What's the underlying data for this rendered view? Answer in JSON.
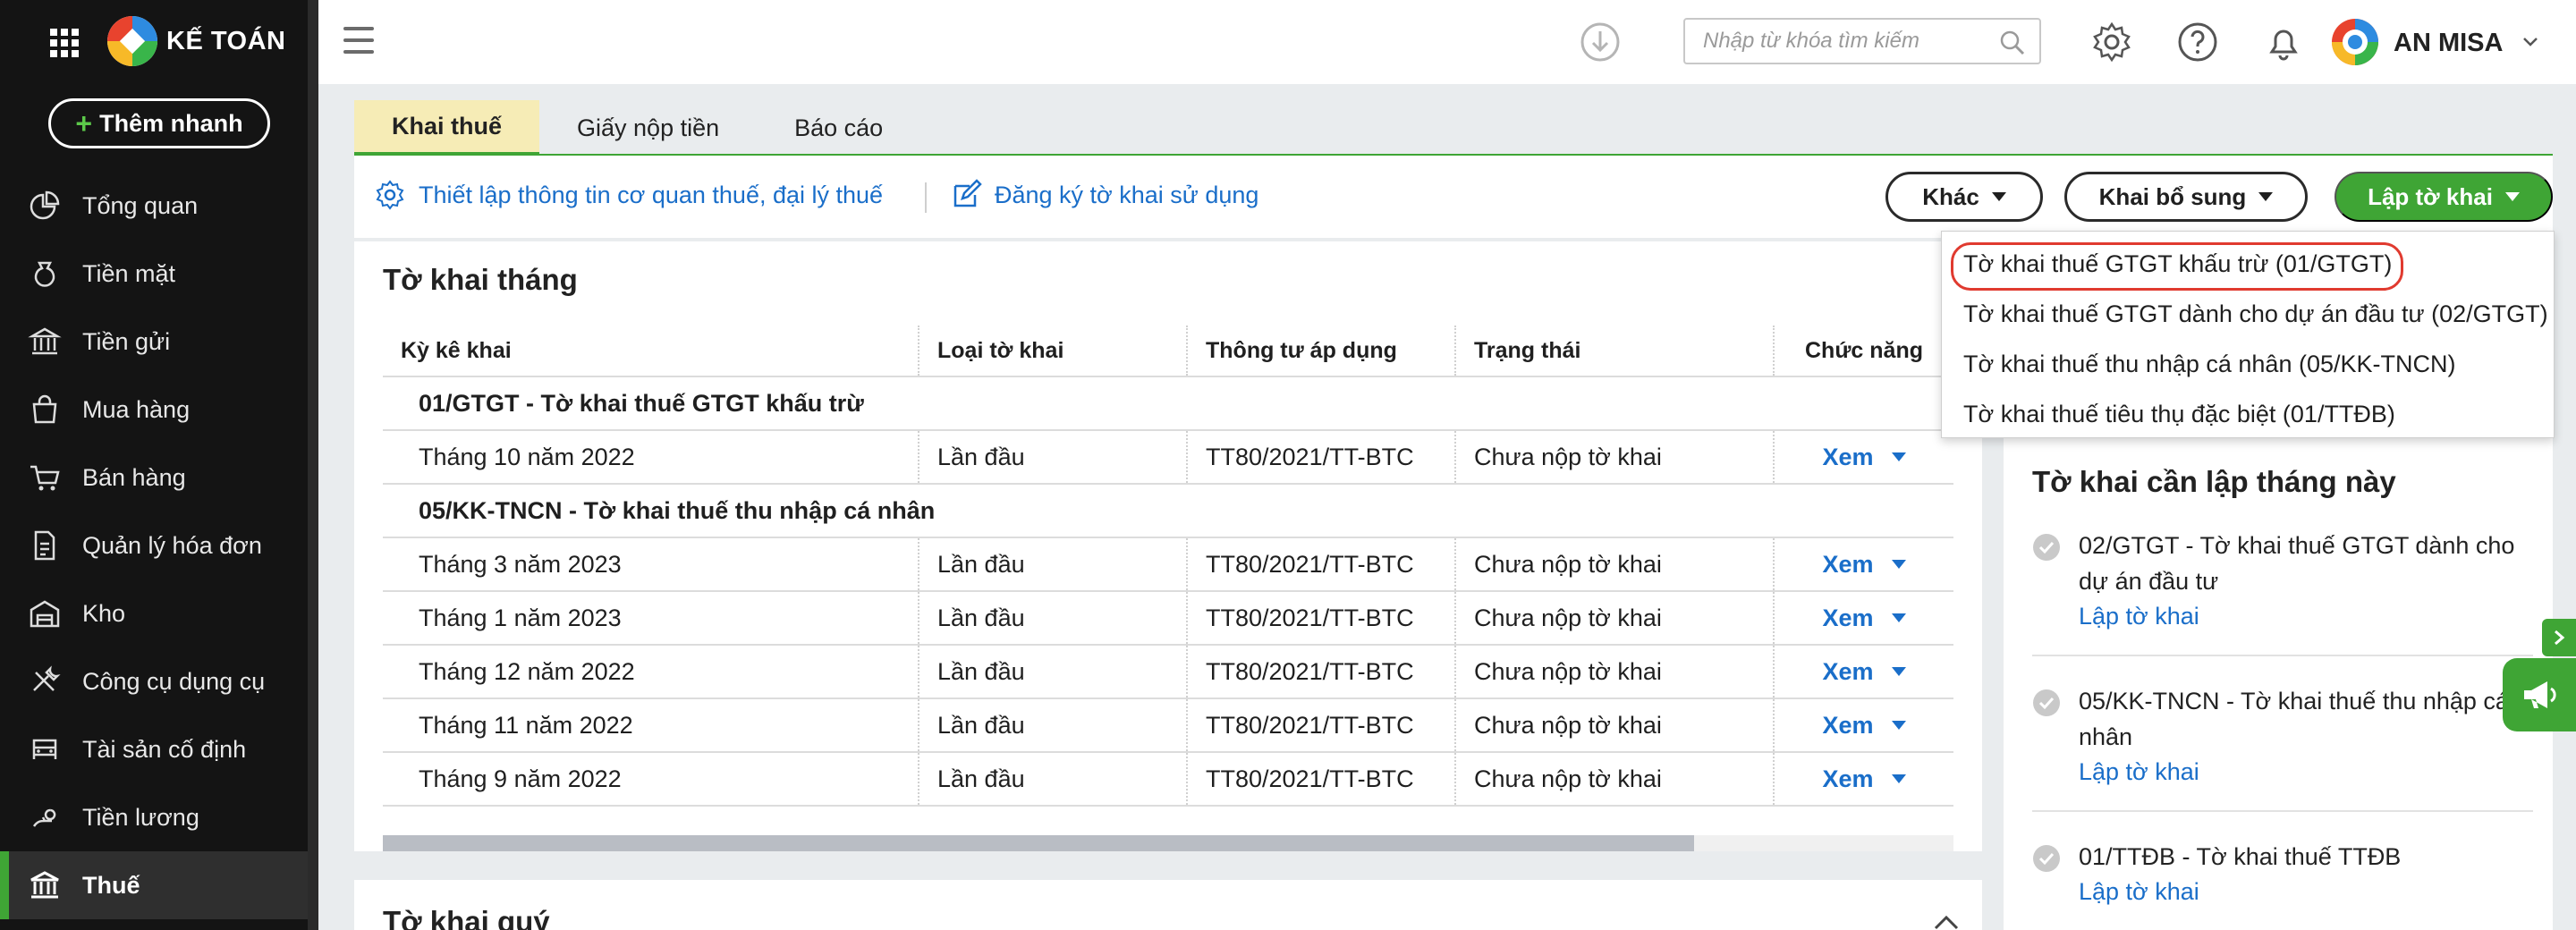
{
  "app": {
    "brand": "KẾ TOÁN",
    "quick_add": "Thêm nhanh"
  },
  "sidebar": {
    "items": [
      {
        "label": "Tổng quan",
        "icon": "pie-chart-icon"
      },
      {
        "label": "Tiền mặt",
        "icon": "money-bag-icon"
      },
      {
        "label": "Tiền gửi",
        "icon": "bank-icon"
      },
      {
        "label": "Mua hàng",
        "icon": "shopping-bag-icon"
      },
      {
        "label": "Bán hàng",
        "icon": "cart-icon"
      },
      {
        "label": "Quản lý hóa đơn",
        "icon": "invoice-icon"
      },
      {
        "label": "Kho",
        "icon": "warehouse-icon"
      },
      {
        "label": "Công cụ dụng cụ",
        "icon": "tools-icon"
      },
      {
        "label": "Tài sản cố định",
        "icon": "car-icon"
      },
      {
        "label": "Tiền lương",
        "icon": "salary-icon"
      },
      {
        "label": "Thuế",
        "icon": "tax-building-icon",
        "active": true
      }
    ]
  },
  "topbar": {
    "search_placeholder": "Nhập từ khóa tìm kiếm",
    "user_name": "AN MISA"
  },
  "tabs": [
    {
      "label": "Khai thuế",
      "active": true
    },
    {
      "label": "Giấy nộp tiền"
    },
    {
      "label": "Báo cáo"
    }
  ],
  "actions": {
    "setup_link": "Thiết lập thông tin cơ quan thuế, đại lý thuế",
    "register_link": "Đăng ký tờ khai sử dụng",
    "other_button": "Khác",
    "supplement_button": "Khai bổ sung",
    "create_button": "Lập tờ khai"
  },
  "dropdown": {
    "items": [
      "Tờ khai thuế GTGT khấu trừ (01/GTGT)",
      "Tờ khai thuế GTGT dành cho dự án đầu tư (02/GTGT)",
      "Tờ khai thuế thu nhập cá nhân (05/KK-TNCN)",
      "Tờ khai thuế tiêu thụ đặc biệt (01/TTĐB)"
    ]
  },
  "monthly": {
    "title": "Tờ khai tháng",
    "columns": [
      "Kỳ kê khai",
      "Loại tờ khai",
      "Thông tư áp dụng",
      "Trạng thái",
      "Chức năng"
    ],
    "groups": [
      {
        "title": "01/GTGT - Tờ khai thuế GTGT khấu trừ",
        "rows": [
          {
            "period": "Tháng 10 năm 2022",
            "type": "Lần đầu",
            "circular": "TT80/2021/TT-BTC",
            "status": "Chưa nộp tờ khai",
            "action": "Xem"
          }
        ]
      },
      {
        "title": "05/KK-TNCN - Tờ khai thuế thu nhập cá nhân",
        "rows": [
          {
            "period": "Tháng 3 năm 2023",
            "type": "Lần đầu",
            "circular": "TT80/2021/TT-BTC",
            "status": "Chưa nộp tờ khai",
            "action": "Xem"
          },
          {
            "period": "Tháng 1 năm 2023",
            "type": "Lần đầu",
            "circular": "TT80/2021/TT-BTC",
            "status": "Chưa nộp tờ khai",
            "action": "Xem"
          },
          {
            "period": "Tháng 12 năm 2022",
            "type": "Lần đầu",
            "circular": "TT80/2021/TT-BTC",
            "status": "Chưa nộp tờ khai",
            "action": "Xem"
          },
          {
            "period": "Tháng 11 năm 2022",
            "type": "Lần đầu",
            "circular": "TT80/2021/TT-BTC",
            "status": "Chưa nộp tờ khai",
            "action": "Xem"
          },
          {
            "period": "Tháng 9 năm 2022",
            "type": "Lần đầu",
            "circular": "TT80/2021/TT-BTC",
            "status": "Chưa nộp tờ khai",
            "action": "Xem"
          }
        ]
      }
    ]
  },
  "quarterly": {
    "title": "Tờ khai quý"
  },
  "todo": {
    "title": "Tờ khai cần lập tháng này",
    "items": [
      {
        "text": "02/GTGT - Tờ khai thuế GTGT dành cho dự án đầu tư",
        "link": "Lập tờ khai"
      },
      {
        "text": "05/KK-TNCN - Tờ khai thuế thu nhập cá nhân",
        "link": "Lập tờ khai"
      },
      {
        "text": "01/TTĐB - Tờ khai thuế TTĐB",
        "link": "Lập tờ khai"
      }
    ]
  },
  "colors": {
    "accent": "#3fa535",
    "link": "#1a6ec9",
    "sidebar": "#141414",
    "highlight": "#e03a2f"
  }
}
